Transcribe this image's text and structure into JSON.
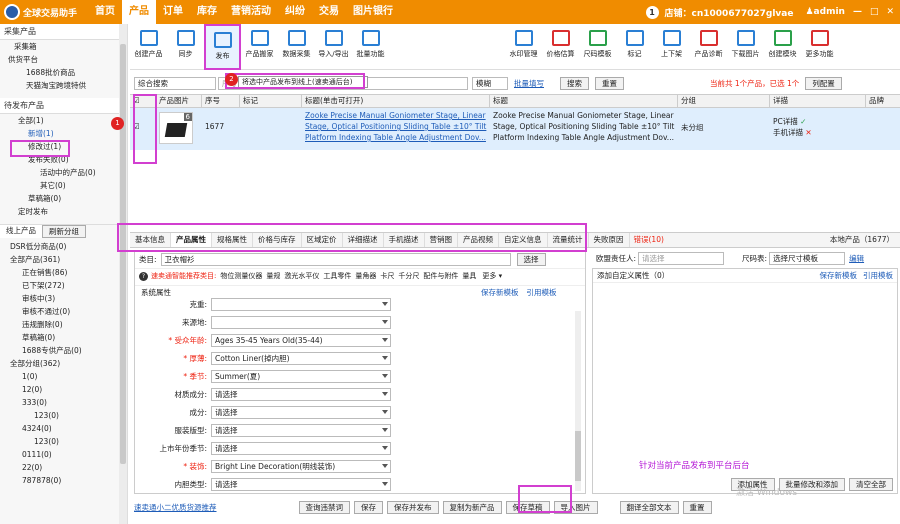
{
  "nav": {
    "logo": "全球交易助手",
    "items": [
      "首页",
      "产品",
      "订单",
      "库存",
      "营销活动",
      "纠纷",
      "交易",
      "图片银行"
    ],
    "active_index": 1,
    "notif": "1",
    "store": "店铺：cn1000677027glvae",
    "user": "admin"
  },
  "sidebar": {
    "cg_title": "采集产品",
    "cg_items": [
      "采集箱",
      "供货平台",
      "1688批价商品",
      "天猫淘宝跨境特供"
    ],
    "pending_title": "待发布产品",
    "pending_items": [
      "全部(1)",
      "新增(1)",
      "修改过(1)",
      "发布失败(0)",
      "活动中的产品(0)",
      "其它(0)",
      "草稿箱(0)",
      "定时发布"
    ],
    "online_tabs": [
      "线上产品",
      "刷新分组"
    ],
    "online_items": [
      "DSR低分商品(0)",
      "全部产品(361)",
      "正在销售(86)",
      "已下架(272)",
      "审核中(3)",
      "审核不通过(0)",
      "违规删除(0)",
      "草稿箱(0)",
      "1688专供产品(0)",
      "全部分组(362)",
      "1(0)",
      "12(0)",
      "333(0)",
      "123(0)",
      "4324(0)",
      "123(0)",
      "0111(0)",
      "22(0)",
      "787878(0)"
    ]
  },
  "toolbar": {
    "left": [
      "创建产品",
      "同步",
      "发布",
      "产品搬家",
      "数据采集",
      "导入/导出",
      "批量功能"
    ],
    "right": [
      "水印管理",
      "价格估算",
      "尺码模板",
      "标记",
      "上下架",
      "产品诊断",
      "下载图片",
      "创建模块",
      "更多功能"
    ]
  },
  "filter": {
    "mode": "综合搜索",
    "placeholder": "序号",
    "tip": "将选中产品发布到线上(速卖通后台)",
    "placeholder2": "多个逗号隔开",
    "mode2": "模糊",
    "batch": "批量填写",
    "search": "搜索",
    "reset": "重置",
    "summary": "当前共 1个产品，已选 1个",
    "config": "列配置"
  },
  "grid": {
    "headers": [
      "产品图片",
      "序号",
      "标记",
      "标题(单击可打开)",
      "标题",
      "分组",
      "详描",
      "品牌"
    ],
    "row": {
      "seq": "1677",
      "title_link": "Zooke Precise Manual Goniometer Stage, Linear Stage, Optical Positioning Sliding Table ±10° Tilt Platform Indexing Table Angle Adjustment Dov...",
      "title2": "Zooke Precise Manual Goniometer Stage, Linear Stage, Optical Positioning Sliding Table ±10° Tilt Platform Indexing Table Angle Adjustment Dov...",
      "group": "未分组",
      "pc": "PC详描",
      "mobile": "手机详描",
      "img_num": "6"
    }
  },
  "tabs": [
    "基本信息",
    "产品属性",
    "规格属性",
    "价格与库存",
    "区域定价",
    "详细描述",
    "手机描述",
    "营销图",
    "产品视频",
    "自定义信息",
    "流量统计",
    "失败原因"
  ],
  "tab_error": "错误(10)",
  "local": "本地产品（1677）",
  "attr": {
    "category_label": "类目:",
    "category": "卫衣帽衫",
    "choose": "选择",
    "tip": "速卖通智能推荐类目:",
    "recs": [
      "物位测量仪器",
      "量规",
      "激光水平仪",
      "工具零件",
      "量角器",
      "卡尺",
      "千分尺",
      "配件与附件",
      "量具"
    ],
    "more": "更多",
    "sys": "系统属性",
    "save_tpl": "保存新模板",
    "cite_tpl": "引用模板",
    "fields": [
      {
        "label": "克重:",
        "value": "",
        "req": false
      },
      {
        "label": "来源地:",
        "value": "",
        "req": false
      },
      {
        "label": "* 受众年龄:",
        "value": "Ages 35-45 Years Old(35-44)",
        "req": true
      },
      {
        "label": "* 厚薄:",
        "value": "Cotton Liner(掉内胆)",
        "req": true
      },
      {
        "label": "* 季节:",
        "value": "Summer(夏)",
        "req": true
      },
      {
        "label": "材质成分:",
        "value": "请选择",
        "req": false
      },
      {
        "label": "成分:",
        "value": "请选择",
        "req": false
      },
      {
        "label": "服装版型:",
        "value": "请选择",
        "req": false
      },
      {
        "label": "上市年份季节:",
        "value": "请选择",
        "req": false
      },
      {
        "label": "* 装饰:",
        "value": "Bright Line Decoration(明线装饰)",
        "req": true
      },
      {
        "label": "内胆类型:",
        "value": "请选择",
        "req": false
      }
    ]
  },
  "right": {
    "resp_label": "欧盟责任人:",
    "resp_ph": "请选择",
    "size_label": "尺码表:",
    "size_ph": "选择尺寸模板",
    "edit": "编辑",
    "custom": "添加自定义属性（0）",
    "save_tpl": "保存新模板",
    "cite_tpl": "引用模板",
    "btns": [
      "添加属性",
      "批量修改和添加",
      "清空全部"
    ],
    "hint": "针对当前产品发布到平台后台"
  },
  "bottom": {
    "link": "速卖通小二优质货源推荐",
    "btns": [
      "查询违禁词",
      "保存",
      "保存并发布",
      "复制为新产品",
      "保存草稿",
      "导入图片",
      "翻译全部文本",
      "重置"
    ],
    "win": "激活 Windows"
  },
  "markers": {
    "m1": "1",
    "m2": "2"
  }
}
